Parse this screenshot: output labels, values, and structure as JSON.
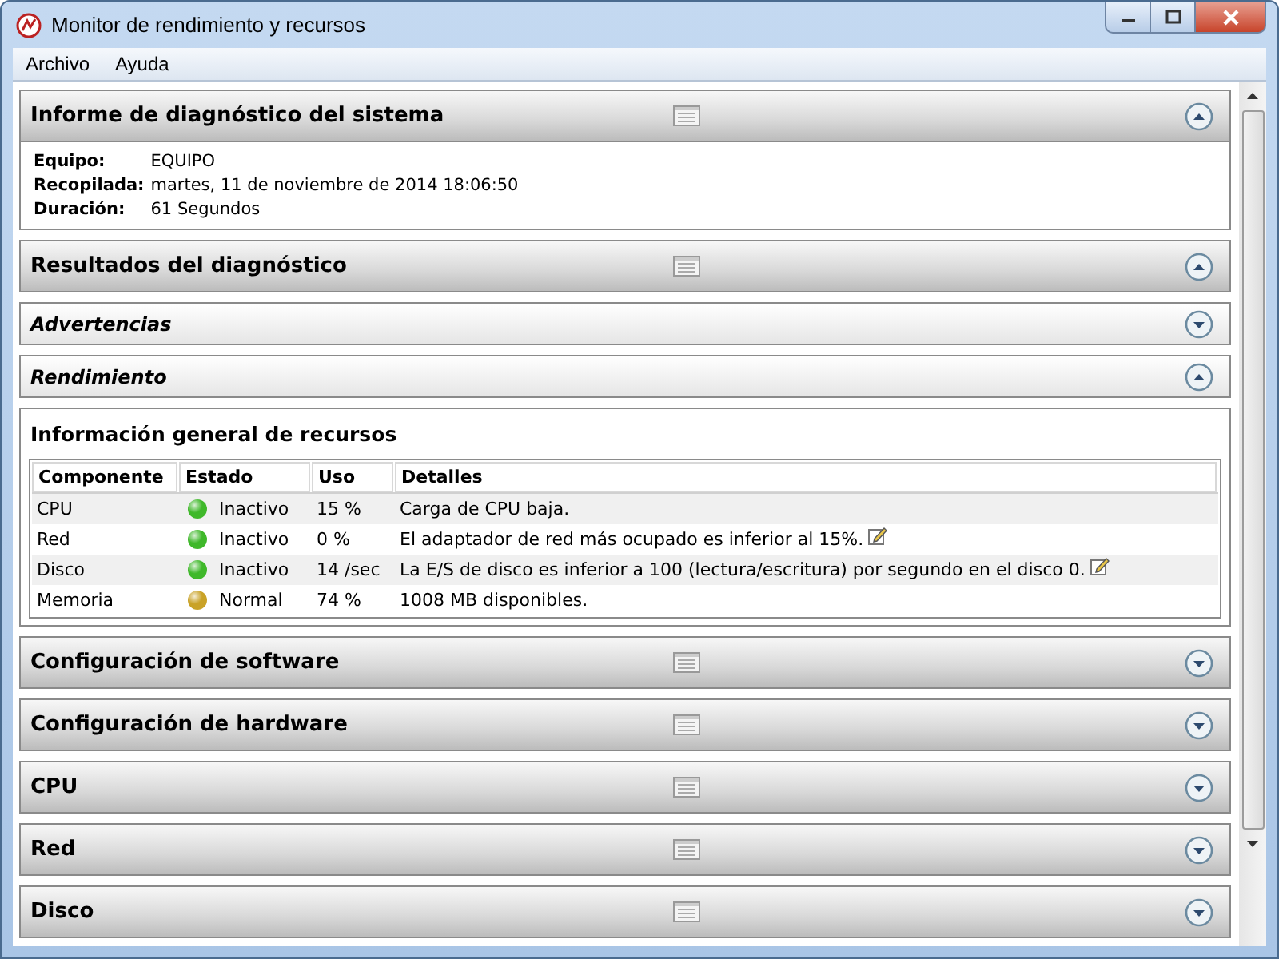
{
  "window": {
    "title": "Monitor de rendimiento y recursos"
  },
  "menu": [
    "Archivo",
    "Ayuda"
  ],
  "sections": [
    {
      "kind": "main",
      "title": "Informe de diagnóstico del sistema",
      "expanded": true,
      "fields": [
        {
          "label": "Equipo:",
          "value": "EQUIPO"
        },
        {
          "label": "Recopilada:",
          "value": "martes, 11 de noviembre de 2014 18:06:50"
        },
        {
          "label": "Duración:",
          "value": "61 Segundos"
        }
      ]
    },
    {
      "kind": "main",
      "title": "Resultados del diagnóstico",
      "expanded": true
    },
    {
      "kind": "sub",
      "title": "Advertencias",
      "expanded": false
    },
    {
      "kind": "sub",
      "title": "Rendimiento",
      "expanded": true,
      "panel": {
        "title": "Información general de recursos",
        "columns": [
          "Componente",
          "Estado",
          "Uso",
          "Detalles"
        ],
        "rows": [
          {
            "component": "CPU",
            "status": "Inactivo",
            "color": "#3fb82a",
            "usage": "15 %",
            "details": "Carga de CPU baja.",
            "note": false
          },
          {
            "component": "Red",
            "status": "Inactivo",
            "color": "#3fb82a",
            "usage": "0 %",
            "details": "El adaptador de red más ocupado es inferior al 15%.",
            "note": true
          },
          {
            "component": "Disco",
            "status": "Inactivo",
            "color": "#3fb82a",
            "usage": "14 /sec",
            "details": "La E/S de disco es inferior a 100 (lectura/escritura) por segundo en el disco 0.",
            "note": true
          },
          {
            "component": "Memoria",
            "status": "Normal",
            "color": "#c9a227",
            "usage": "74 %",
            "details": "1008 MB disponibles.",
            "note": false
          }
        ]
      }
    },
    {
      "kind": "main",
      "title": "Configuración de software",
      "expanded": false
    },
    {
      "kind": "main",
      "title": "Configuración de hardware",
      "expanded": false
    },
    {
      "kind": "main",
      "title": "CPU",
      "expanded": false
    },
    {
      "kind": "main",
      "title": "Red",
      "expanded": false
    },
    {
      "kind": "main",
      "title": "Disco",
      "expanded": false
    }
  ]
}
